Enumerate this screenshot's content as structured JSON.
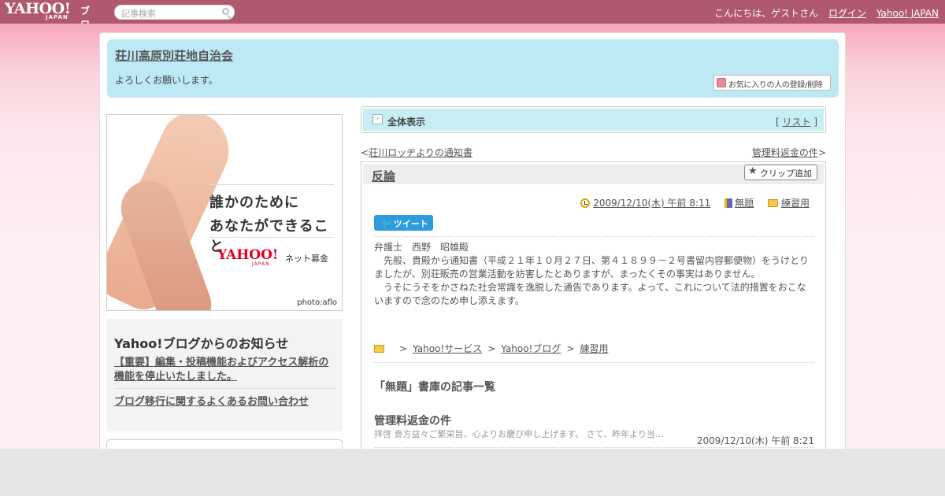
{
  "header": {
    "logo_text": "YAHOO!",
    "logo_sub": "JAPAN",
    "logo_blog": "ブログ",
    "search_placeholder": "記事検索",
    "greeting": "こんにちは、ゲストさん",
    "login": "ログイン",
    "yahoo_japan": "Yahoo! JAPAN"
  },
  "blog": {
    "title": "荘川高原別荘地自治会",
    "description": "よろしくお願いします。",
    "favorite_button": "お気に入りの人の登録/削除"
  },
  "banner": {
    "line1": "誰かのために",
    "line2": "あなたができること",
    "logo": "YAHOO!",
    "logo_sub": "JAPAN",
    "service": "ネット募金",
    "credit": "photo:aflo"
  },
  "notice": {
    "title": "Yahoo!ブログからのお知らせ",
    "items": [
      "【重要】編集・投稿機能およびアクセス解析の機能を停止いたしました。",
      "ブログ移行に関するよくあるお問い合わせ"
    ]
  },
  "view": {
    "all_label": "全体表示",
    "list_open": "[",
    "list_label": "リスト",
    "list_close": "]"
  },
  "nav": {
    "prev_mark": "<",
    "prev_label": "荘川ロッヂよりの通知書",
    "next_label": "管理料返金の件",
    "next_mark": ">"
  },
  "article": {
    "title": "反論",
    "clip_button": "クリップ追加",
    "datetime": "2009/12/10(木) 午前 8:11",
    "category": "無題",
    "folder": "練習用",
    "tweet": "ツイート",
    "body": [
      "弁護士　西野　昭雄殿",
      "",
      "　先般、貴殿から通知書（平成２１年１０月２７日、第４１８９９－２号書留内容郵便物）をうけとりましたが、別荘販売の営業活動を妨害したとありますが、まったくその事実はありません。",
      "　うそにうそをかさねた社会常識を逸脱した通告であります。よって、これについて法的措置をおこないますので念のため申し添えます。"
    ],
    "breadcrumb": [
      "Yahoo!サービス",
      "Yahoo!ブログ",
      "練習用"
    ],
    "breadcrumb_sep": ">"
  },
  "archive": {
    "heading": "「無題」書庫の記事一覧",
    "entries": [
      {
        "title": "管理料返金の件",
        "snippet": "拝啓 貴方益々ご繁栄旨、心よりお慶び申し上げます。 さて、昨年より当…",
        "date": "2009/12/10(木) 午前 8:21"
      }
    ]
  },
  "colors": {
    "header_bg": "#b0586c",
    "title_panel_bg": "#bde9f4",
    "tab_bg": "#c6eef3",
    "tweet_blue": "#2d9be0"
  }
}
